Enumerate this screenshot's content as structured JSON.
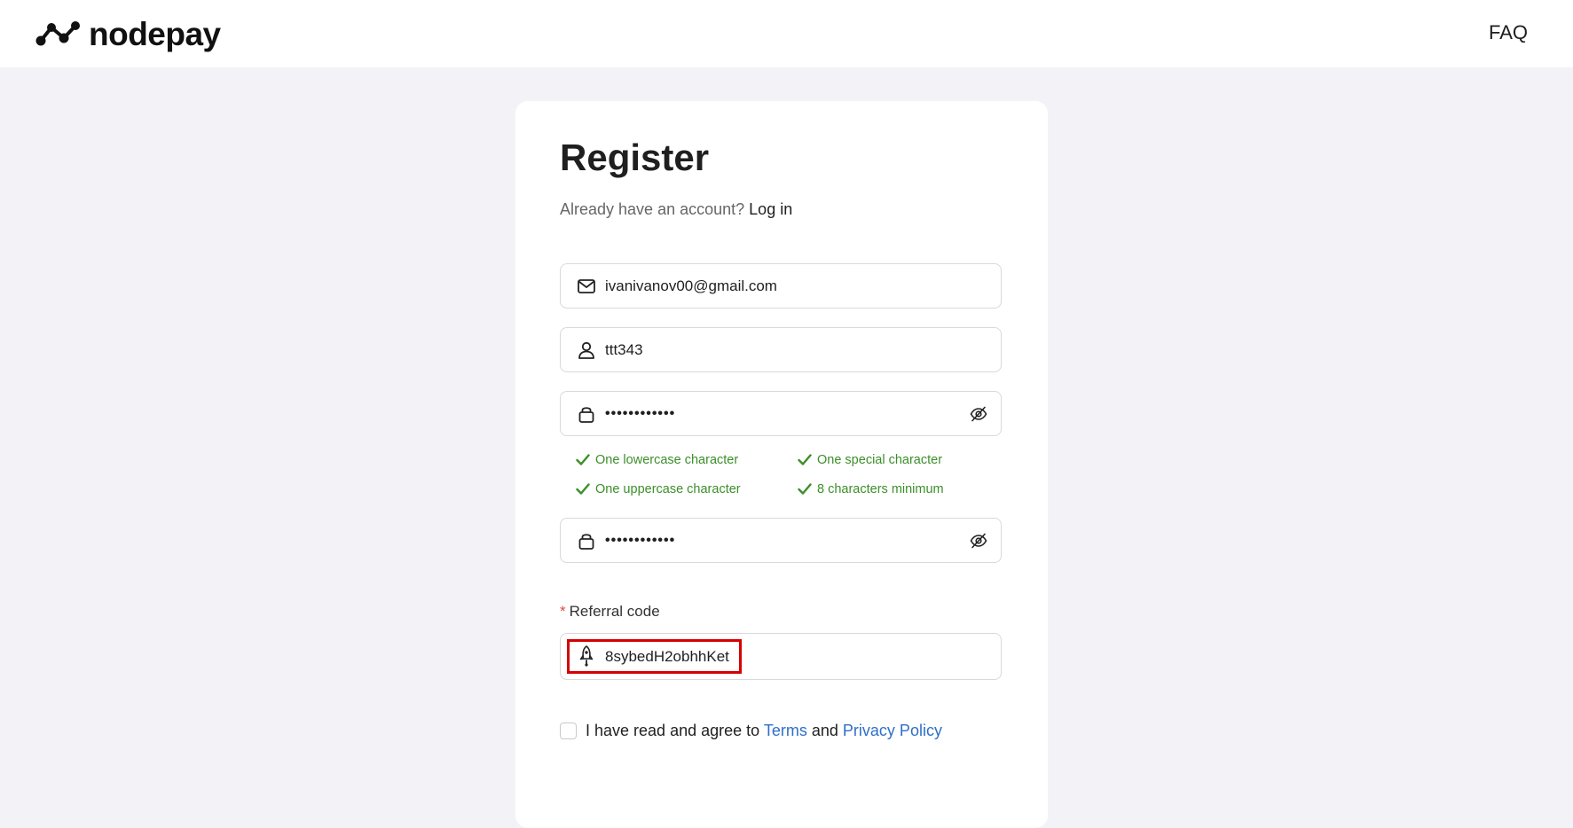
{
  "header": {
    "brand": "nodepay",
    "faq_label": "FAQ"
  },
  "form": {
    "title": "Register",
    "login_prompt": "Already have an account?",
    "login_link": "Log in",
    "email_value": "ivanivanov00@gmail.com",
    "username_value": "ttt343",
    "password_value": "••••••••••••",
    "confirm_password_value": "••••••••••••",
    "password_rules": [
      "One lowercase character",
      "One special character",
      "One uppercase character",
      "8 characters minimum"
    ],
    "referral_required_mark": "*",
    "referral_label": "Referral code",
    "referral_value": "8sybedH2obhhKet",
    "agree_text": "I have read and agree to",
    "agree_and": "and",
    "terms_link": "Terms",
    "privacy_link": "Privacy Policy"
  },
  "colors": {
    "page_bg": "#f3f3f7",
    "rule_ok": "#3b8f29",
    "link": "#2f6fc9",
    "highlight": "#d60000"
  },
  "icons": [
    "nodepay-logo-icon",
    "mail-icon",
    "user-icon",
    "lock-icon",
    "eye-off-icon",
    "check-icon",
    "rocket-icon"
  ]
}
